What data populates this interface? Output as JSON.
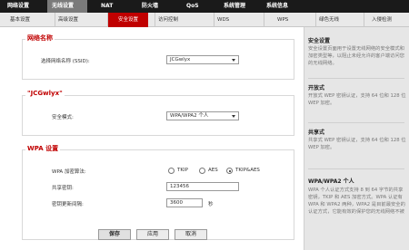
{
  "top_nav": [
    "网络设置",
    "无线设置",
    "NAT",
    "防火墙",
    "QoS",
    "系统管理",
    "系统信息"
  ],
  "sub_nav": [
    "基本设置",
    "高级设置",
    "安全设置",
    "访问控制",
    "WDS",
    "WPS",
    "绿色无线",
    "入侵检测"
  ],
  "network_section": {
    "title": "网络名称",
    "select_label": "选择网络名称 (SSID):",
    "select_value": "JCGwlyx"
  },
  "ssid_section": {
    "title": "\"JCGwlyx\"",
    "mode_label": "安全模式:",
    "mode_value": "WPA/WPA2 个人"
  },
  "wpa_section": {
    "title": "WPA 设置",
    "algo_label": "WPA 加密算法:",
    "algo_options": [
      "TKIP",
      "AES",
      "TKIP&AES"
    ],
    "algo_selected": "TKIP&AES",
    "key_label": "共享密钥:",
    "key_value": "123456",
    "interval_label": "密钥更新间隔:",
    "interval_value": "3600",
    "interval_unit": "秒"
  },
  "buttons": {
    "save": "保存",
    "apply": "应用",
    "cancel": "取消"
  },
  "help": {
    "security_title": "安全设置",
    "security_text": "安全设置页面用于设置无线网络的安全模式和加密类型等，以阻止未经允许的客户端访问您的无线网络。",
    "open_title": "开放式",
    "open_text": "开放式 WEP 密钥认证，支持 64 位和 128 位 WEP 加密。",
    "shared_title": "共享式",
    "shared_text": "共享式 WEP 密钥认证，支持 64 位和 128 位 WEP 加密。",
    "wpa_title": "WPA/WPA2 个人",
    "wpa_text": "WPA 个人认证方式支持 8 到 64 字节的共享密钥，TKIP 和 AES 加密方式。WPA 认证有 WPA 和 WPA2 两种，WPA2 是目前最安全的认证方式，它能有效的保护您的无线网络不被"
  },
  "colors": {
    "accent": "#c00000",
    "topbar": "#1a1a1a",
    "sidebar": "#e6e6e6"
  }
}
